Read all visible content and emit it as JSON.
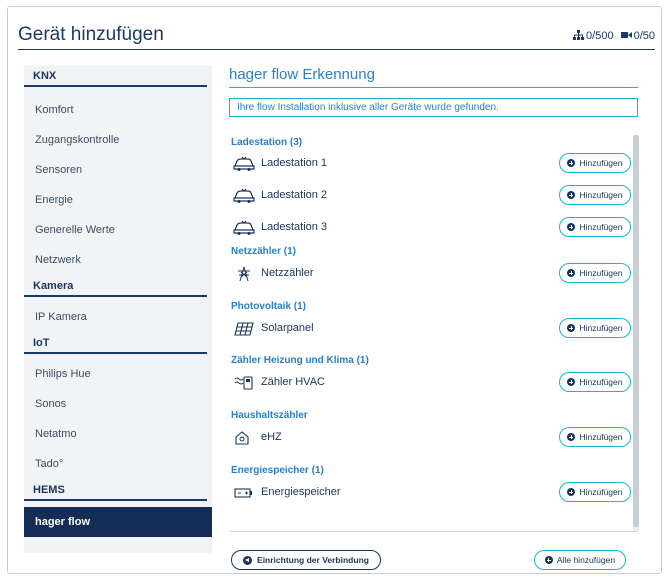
{
  "dialog": {
    "title": "Gerät hinzufügen",
    "counter_devices": "0/500",
    "counter_cameras": "0/50"
  },
  "sidebar": {
    "sections": [
      {
        "label": "KNX",
        "items": [
          {
            "label": "Komfort"
          },
          {
            "label": "Zugangskontrolle"
          },
          {
            "label": "Sensoren"
          },
          {
            "label": "Energie"
          },
          {
            "label": "Generelle Werte"
          },
          {
            "label": "Netzwerk"
          }
        ]
      },
      {
        "label": "Kamera",
        "items": [
          {
            "label": "IP Kamera"
          }
        ]
      },
      {
        "label": "IoT",
        "items": [
          {
            "label": "Philips Hue"
          },
          {
            "label": "Sonos"
          },
          {
            "label": "Netatmo"
          },
          {
            "label": "Tado°"
          }
        ]
      },
      {
        "label": "HEMS",
        "items": [
          {
            "label": "hager flow",
            "active": true
          }
        ]
      }
    ]
  },
  "main": {
    "title": "hager flow Erkennung",
    "info": "Ihre flow Installation inklusive aller Geräte wurde gefunden.",
    "add_label": "Hinzufügen",
    "categories": [
      {
        "label": "Ladestation (3)",
        "devices": [
          {
            "label": "Ladestation 1",
            "icon": "car-icon"
          },
          {
            "label": "Ladestation 2",
            "icon": "car-icon"
          },
          {
            "label": "Ladestation 3",
            "icon": "car-icon"
          }
        ]
      },
      {
        "label": "Netzzähler (1)",
        "devices": [
          {
            "label": "Netzzähler",
            "icon": "power-pylon-icon"
          }
        ]
      },
      {
        "label": "Photovoltaik (1)",
        "devices": [
          {
            "label": "Solarpanel",
            "icon": "solar-panel-icon"
          }
        ]
      },
      {
        "label": "Zähler Heizung und Klima (1)",
        "devices": [
          {
            "label": "Zähler HVAC",
            "icon": "hvac-meter-icon"
          }
        ]
      },
      {
        "label": "Haushaltszähler",
        "devices": [
          {
            "label": "eHZ",
            "icon": "house-meter-icon"
          }
        ]
      },
      {
        "label": "Energiespeicher (1)",
        "devices": [
          {
            "label": "Energiespeicher",
            "icon": "battery-icon"
          }
        ]
      }
    ],
    "connection_button": "Einrichtung der Verbindung",
    "add_all_button": "Alle hinzufügen"
  },
  "colors": {
    "navy": "#1b3557",
    "accent_blue": "#2b7fc2",
    "accent_teal": "#16b9c9",
    "sidebar_bg": "#f1f3f6",
    "active_bg": "#142d55"
  }
}
